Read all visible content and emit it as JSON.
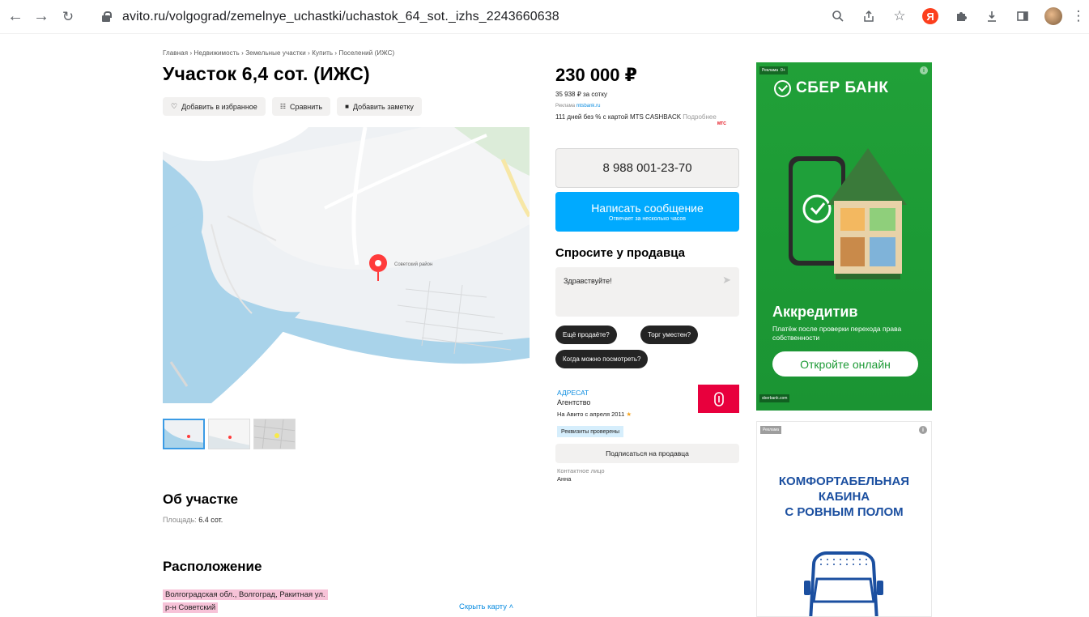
{
  "browser": {
    "url": "avito.ru/volgograd/zemelnye_uchastki/uchastok_64_sot._izhs_2243660638",
    "yandex_letter": "Я"
  },
  "listing": {
    "breadcrumb": "Главная › Недвижимость › Земельные участки › Купить › Поселений (ИЖС)",
    "title": "Участок 6,4 сот. (ИЖС)",
    "actions": {
      "favorite": "Добавить в избранное",
      "compare": "Сравнить",
      "note": "Добавить заметку"
    },
    "map_label": "Советский район",
    "about_heading": "Об участке",
    "area_label": "Площадь:",
    "area_value": "6.4 сот.",
    "location_heading": "Расположение",
    "address_line1": "Волгоградская обл., Волгоград, Ракитная ул.",
    "address_line2": "р-н Советский",
    "hide_map": "Скрыть карту ˄"
  },
  "sidebar": {
    "price": "230 000 ₽",
    "price_per": "35 938 ₽ за сотку",
    "promo_tag": "Реклама",
    "promo_domain": "mtsbank.ru",
    "promo_text": "111 дней без % с картой MTS CASHBACK",
    "promo_more": "Подробнее",
    "promo_logo": "МТС",
    "phone": "8 988 001-23-70",
    "message_btn": "Написать сообщение",
    "message_sub": "Отвечает за несколько часов",
    "ask_heading": "Спросите у продавца",
    "ask_text": "Здравствуйте!",
    "chips": [
      "Ещё продаёте?",
      "Торг уместен?",
      "Когда можно посмотреть?"
    ],
    "seller_name": "АДРЕСАТ",
    "seller_type": "Агентство",
    "seller_since": "На Авито с апреля 2011",
    "seller_badge": "Реквизиты проверены",
    "subscribe": "Подписаться на продавца",
    "contact_label": "Контактное лицо",
    "contact_name": "Анна"
  },
  "ads": {
    "ad1": {
      "tag": "Реклама",
      "age": "0+",
      "brand": "СБЕР БАНК",
      "heading": "Аккредитив",
      "sub": "Платёж после проверки перехода права собственности",
      "button": "Откройте онлайн",
      "domain": "sberbank.com"
    },
    "ad2": {
      "tag": "Реклама",
      "text": [
        "КОМФОРТАБЕЛЬНАЯ",
        "КАБИНА",
        "С РОВНЫМ ПОЛОМ"
      ]
    }
  },
  "colors": {
    "primary_blue": "#00aaff",
    "link_blue": "#0a8ce0",
    "sber_green": "#21a038",
    "highlight_pink": "#f7c3d8"
  }
}
